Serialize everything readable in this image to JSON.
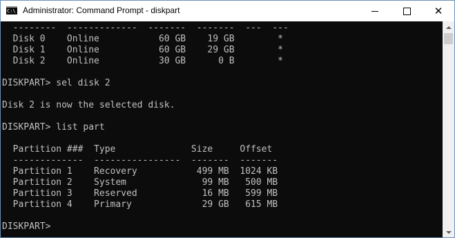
{
  "window": {
    "title": "Administrator: Command Prompt - diskpart",
    "icon_label": "C:\\",
    "controls": {
      "minimize": "minimize-icon",
      "maximize": "maximize-icon",
      "close": "close-icon",
      "close_glyph": "✕"
    }
  },
  "console": {
    "lines": [
      "  --------  -------------  -------  -------  ---  ---",
      "  Disk 0    Online           60 GB    19 GB        *",
      "  Disk 1    Online           60 GB    29 GB        *",
      "  Disk 2    Online           30 GB      0 B        *",
      "",
      "DISKPART> sel disk 2",
      "",
      "Disk 2 is now the selected disk.",
      "",
      "DISKPART> list part",
      "",
      "  Partition ###  Type              Size     Offset",
      "  -------------  ----------------  -------  -------",
      "  Partition 1    Recovery           499 MB  1024 KB",
      "  Partition 2    System              99 MB   500 MB",
      "  Partition 3    Reserved            16 MB   599 MB",
      "  Partition 4    Primary             29 GB   615 MB",
      "",
      "DISKPART>"
    ]
  },
  "colors": {
    "console_bg": "#0c0c0c",
    "console_text": "#c0c0c0",
    "titlebar_bg": "#ffffff",
    "scrollbar_bg": "#f0f0f0"
  }
}
